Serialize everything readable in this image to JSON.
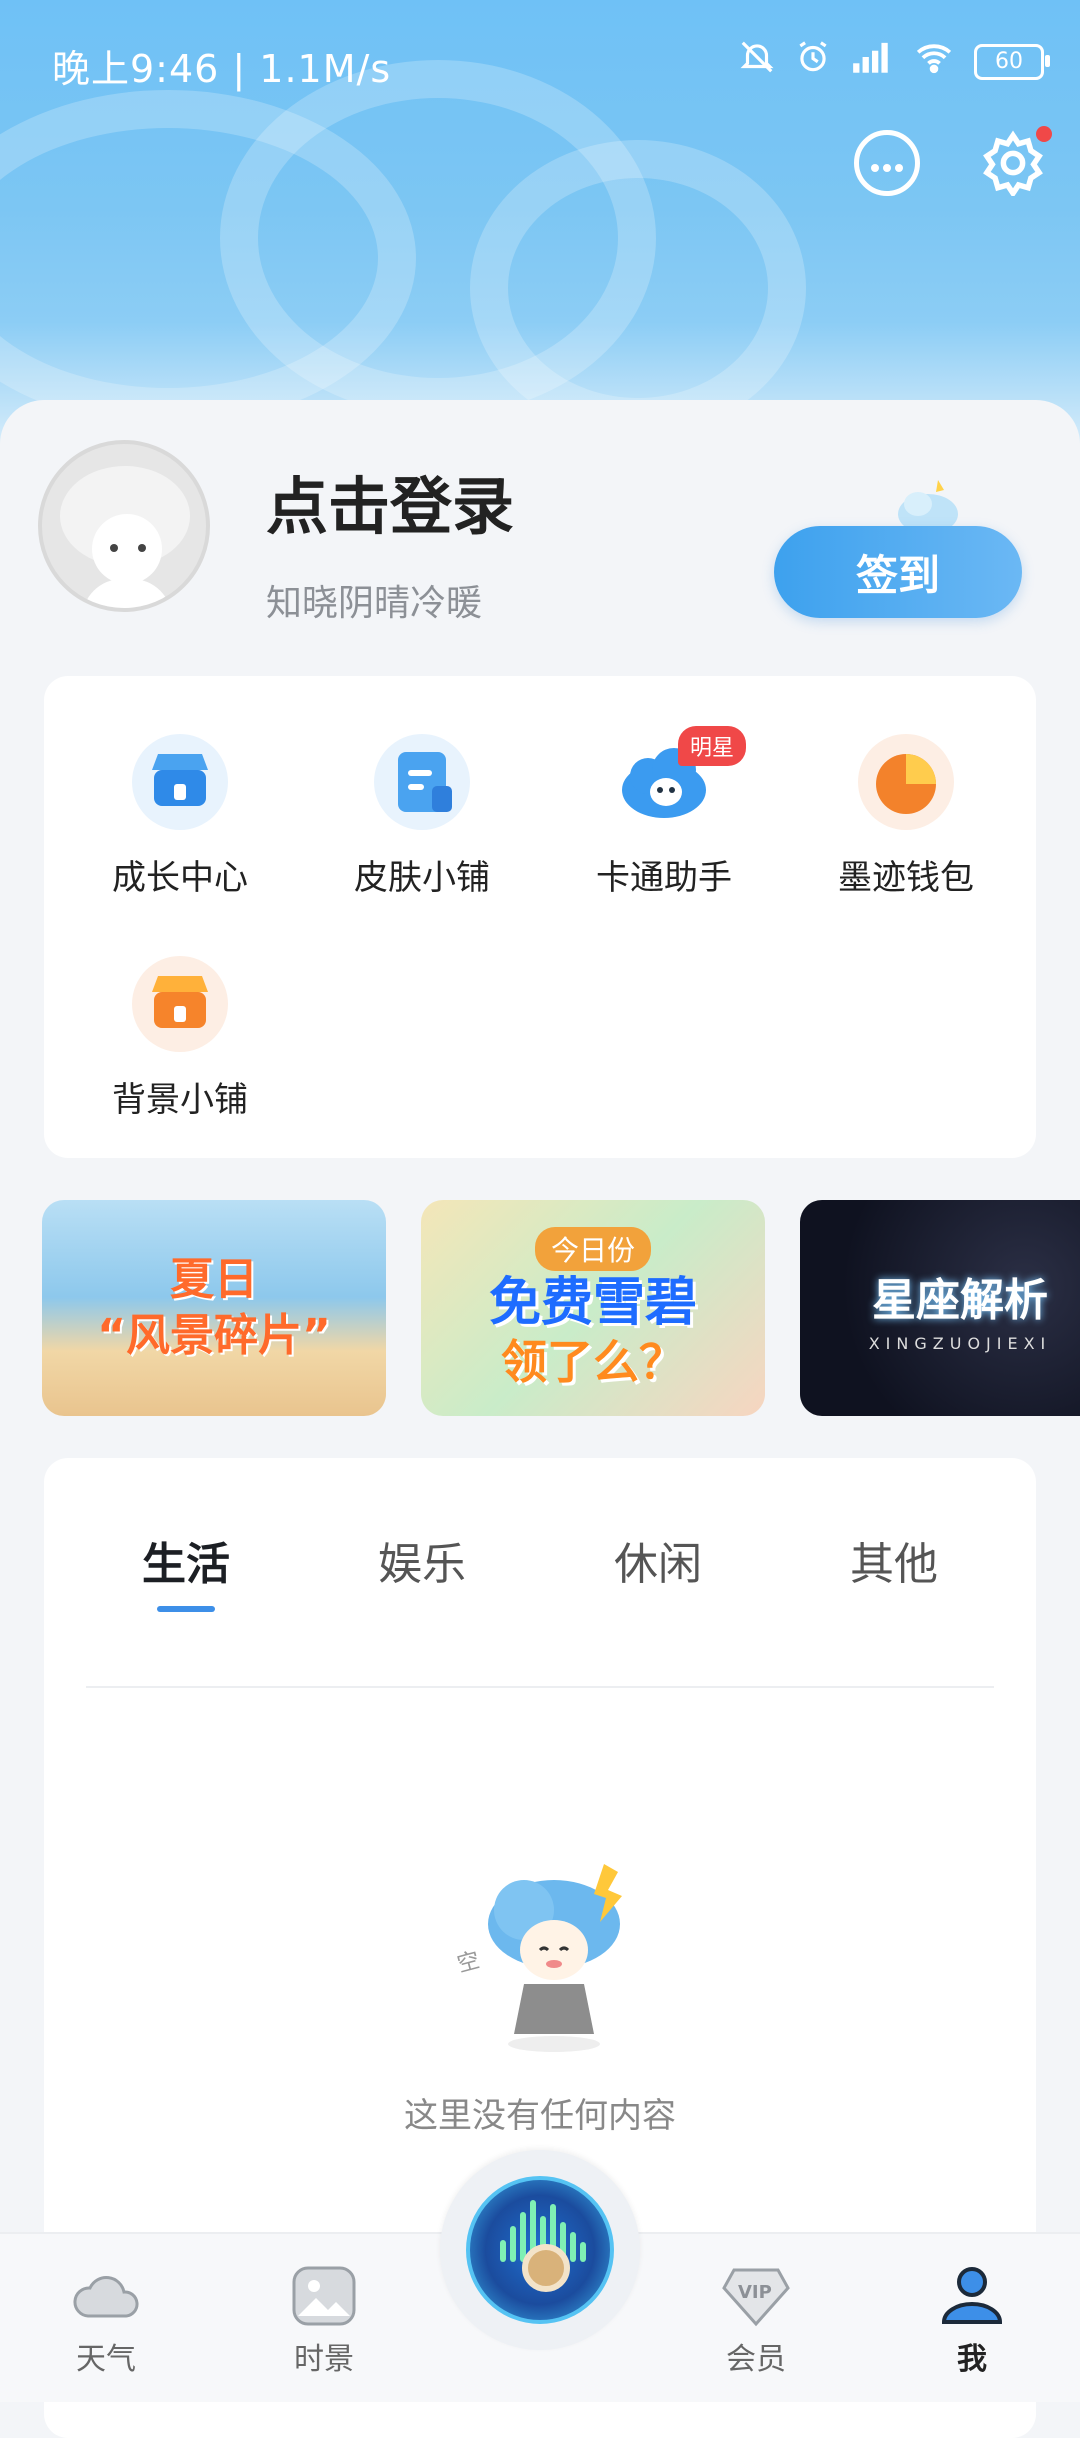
{
  "status_bar": {
    "time_speed": "晚上9:46 | 1.1M/s",
    "battery": "60"
  },
  "profile": {
    "title": "点击登录",
    "subtitle": "知晓阴晴冷暖",
    "signin_label": "签到"
  },
  "features": [
    {
      "label": "成长中心",
      "icon": "shop-blue-icon"
    },
    {
      "label": "皮肤小铺",
      "icon": "document-icon"
    },
    {
      "label": "卡通助手",
      "icon": "cloud-mascot-icon",
      "badge": "明星"
    },
    {
      "label": "墨迹钱包",
      "icon": "pie-wallet-icon"
    },
    {
      "label": "背景小铺",
      "icon": "shop-orange-icon"
    }
  ],
  "banners": [
    {
      "line1": "夏日",
      "line2": "“风景碎片”"
    },
    {
      "tag": "今日份",
      "line1": "免费雪碧",
      "line2": "领了么？"
    },
    {
      "line1": "星座解析",
      "line2": "XINGZUOJIEXI"
    }
  ],
  "tabs": [
    "生活",
    "娱乐",
    "休闲",
    "其他"
  ],
  "empty_state": {
    "text": "这里没有任何内容"
  },
  "bottom_nav": [
    {
      "label": "天气",
      "icon": "cloud-icon"
    },
    {
      "label": "时景",
      "icon": "image-icon"
    },
    {
      "label": "会员",
      "icon": "vip-icon"
    },
    {
      "label": "我",
      "icon": "profile-icon"
    }
  ],
  "colors": {
    "accent": "#3d8fe8",
    "badge_red": "#f04848",
    "header_blue": "#6fc1f6"
  }
}
